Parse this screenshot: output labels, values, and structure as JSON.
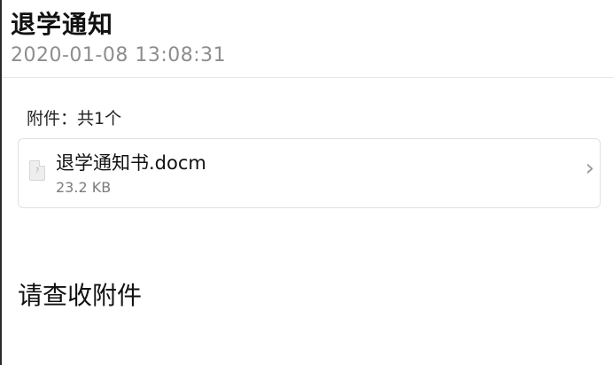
{
  "mail": {
    "subject": "退学通知",
    "timestamp": "2020-01-08 13:08:31",
    "body": "请查收附件"
  },
  "attachments": {
    "heading": "附件：共1个",
    "items": [
      {
        "name": "退学通知书.docm",
        "size": "23.2 KB",
        "icon": "document-file-icon"
      }
    ],
    "chevron": "›"
  },
  "colors": {
    "timestamp": "#8e8e8e",
    "card_border": "#e1e1e1",
    "divider": "#e6e6e6"
  }
}
